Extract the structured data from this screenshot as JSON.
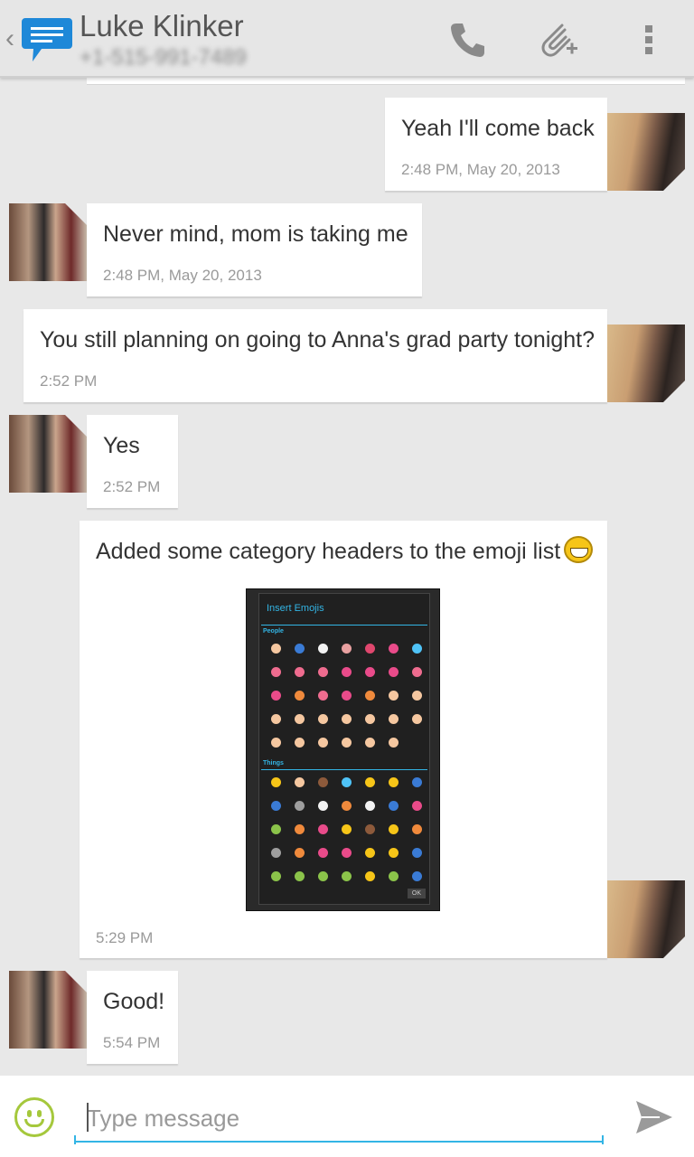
{
  "header": {
    "contact_name": "Luke Klinker",
    "contact_number": "+1-515-991-7489"
  },
  "messages": [
    {
      "text": "Yeah I'll come back",
      "time": "2:48 PM, May 20, 2013",
      "sender": "me"
    },
    {
      "text": "Never mind, mom is taking me",
      "time": "2:48 PM, May 20, 2013",
      "sender": "contact"
    },
    {
      "text": "You still planning on going to Anna's grad party tonight?",
      "time": "2:52 PM",
      "sender": "me"
    },
    {
      "text": "Yes",
      "time": "2:52 PM",
      "sender": "contact"
    },
    {
      "text": "Added some category headers to the emoji list",
      "time": "5:29 PM",
      "sender": "me",
      "attachment": "screenshot"
    },
    {
      "text": "Good!",
      "time": "5:54 PM",
      "sender": "contact"
    }
  ],
  "attachment": {
    "title": "Insert Emojis",
    "category_people": "People",
    "category_things": "Things",
    "ok_label": "OK"
  },
  "composer": {
    "placeholder": "Type message"
  },
  "icons": {
    "back": "chevron-left-icon",
    "app": "chat-bubble-icon",
    "call": "phone-icon",
    "attach": "paperclip-add-icon",
    "menu": "overflow-menu-icon",
    "emoji": "smiley-icon",
    "send": "send-icon"
  },
  "colors": {
    "accent": "#33b5e5",
    "emoji_button": "#a5c83c"
  }
}
